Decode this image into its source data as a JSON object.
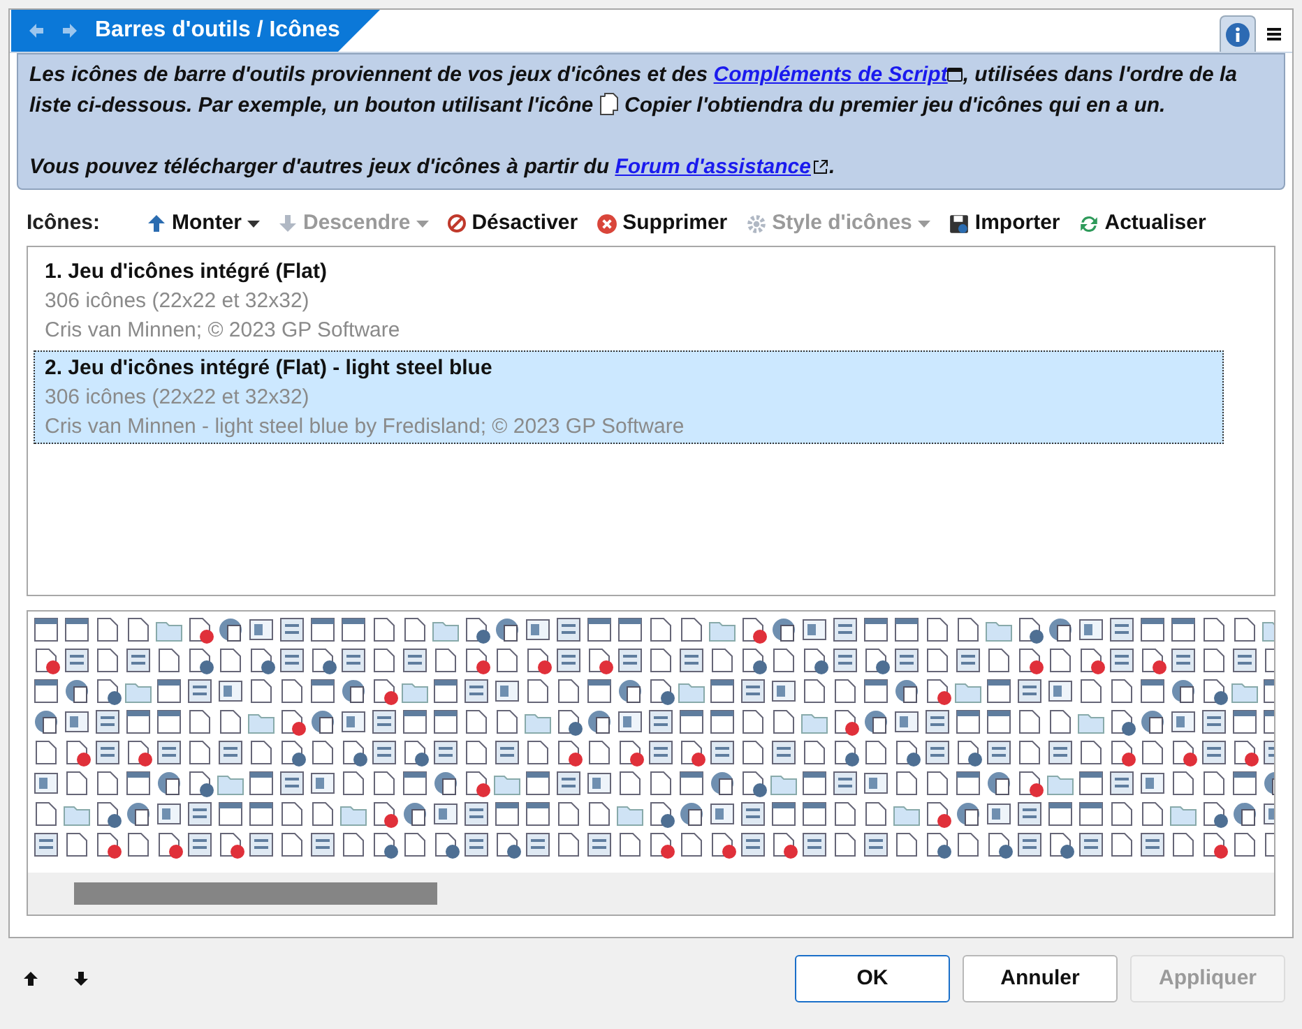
{
  "header": {
    "title": "Barres d'outils / Icônes",
    "info_selected": true
  },
  "info": {
    "paragraphs": [
      [
        {
          "kind": "text",
          "text": "Les icônes de barre d'outils proviennent de vos jeux d'icônes et des "
        },
        {
          "kind": "link-panel",
          "text": "Compléments de Script"
        },
        {
          "kind": "text",
          "text": ", utilisées dans l'ordre de la liste ci-dessous. Par exemple, un bouton utilisant l'icône "
        },
        {
          "kind": "doc-icon"
        },
        {
          "kind": "text",
          "text": " Copier l'obtiendra du premier jeu d'icônes qui en a un."
        }
      ],
      [
        {
          "kind": "text",
          "text": "Vous pouvez télécharger d'autres jeux d'icônes à partir du "
        },
        {
          "kind": "link-external",
          "text": "Forum d'assistance"
        },
        {
          "kind": "text",
          "text": "."
        }
      ]
    ]
  },
  "toolbar": {
    "label": "Icônes:",
    "items": [
      {
        "kind": "up",
        "label": "Monter",
        "disabled": false,
        "dropdown": true
      },
      {
        "kind": "down",
        "label": "Descendre",
        "disabled": true,
        "dropdown": true
      },
      {
        "kind": "disable",
        "label": "Désactiver",
        "disabled": false,
        "dropdown": false
      },
      {
        "kind": "delete",
        "label": "Supprimer",
        "disabled": false,
        "dropdown": false
      },
      {
        "kind": "style",
        "label": "Style d'icônes",
        "disabled": true,
        "dropdown": true
      },
      {
        "kind": "import",
        "label": "Importer",
        "disabled": false,
        "dropdown": false
      },
      {
        "kind": "refresh",
        "label": "Actualiser",
        "disabled": false,
        "dropdown": false
      }
    ]
  },
  "sets": [
    {
      "title": "1. Jeu d'icônes intégré (Flat)",
      "count": "306 icônes (22x22 et 32x32)",
      "author": "Cris van Minnen; © 2023 GP Software",
      "selected": false
    },
    {
      "title": "2. Jeu d'icônes intégré (Flat) - light steel blue",
      "count": "306 icônes (22x22 et 32x32)",
      "author": "Cris van Minnen - light steel blue by Fredisland; © 2023 GP Software",
      "selected": true
    }
  ],
  "buttons": [
    {
      "label": "OK",
      "disabled": false,
      "default": true
    },
    {
      "label": "Annuler",
      "disabled": false,
      "default": false
    },
    {
      "label": "Appliquer",
      "disabled": true,
      "default": false
    }
  ]
}
